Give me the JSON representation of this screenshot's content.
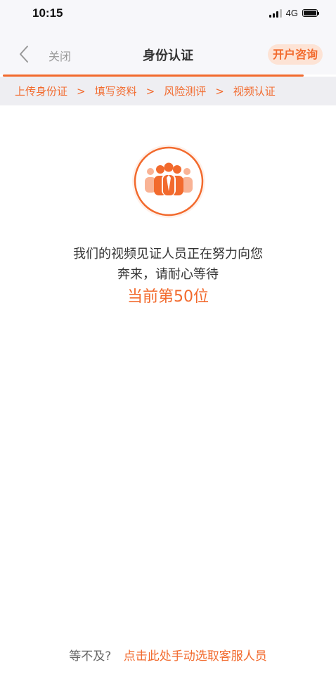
{
  "status_bar": {
    "time": "10:15",
    "network": "4G",
    "icons": [
      "signal-icon",
      "battery-icon"
    ]
  },
  "nav": {
    "back_icon": "chevron-left-icon",
    "close_label": "关闭",
    "title": "身份认证",
    "consult_label": "开户咨询"
  },
  "steps": [
    {
      "label": "上传身份证"
    },
    {
      "label": "填写资料"
    },
    {
      "label": "风险测评"
    },
    {
      "label": "视频认证"
    }
  ],
  "step_separator": ">",
  "illustration": {
    "icon": "people-group-icon",
    "colors": {
      "accent": "#f26a2d",
      "light": "#f9b395"
    }
  },
  "waiting": {
    "line1": "我们的视频见证人员正在努力向您",
    "line2": "奔来，请耐心等待",
    "queue": "当前第50位"
  },
  "footer": {
    "prefix": "等不及?",
    "link": "点击此处手动选取客服人员"
  },
  "colors": {
    "accent": "#f26a2d",
    "nav_background": "#f7f7fa",
    "steps_background": "#eeeef2"
  }
}
